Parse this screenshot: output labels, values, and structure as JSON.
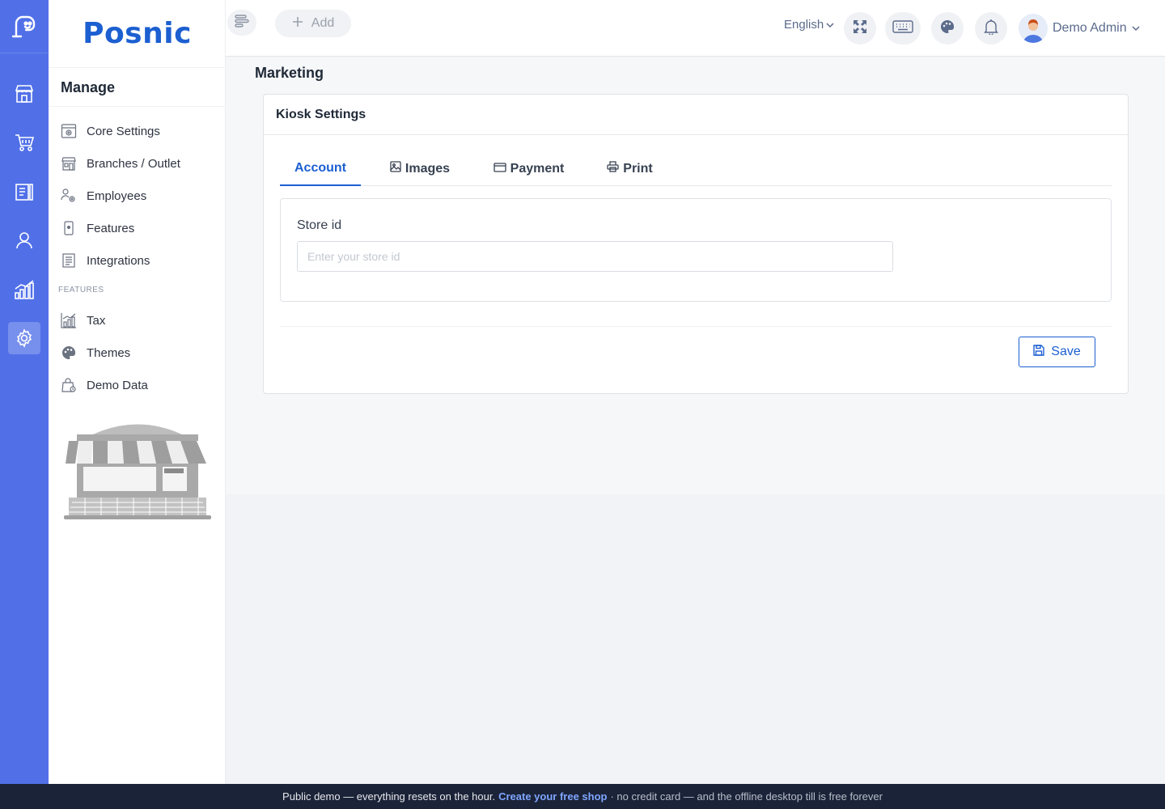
{
  "brand": {
    "name": "Posnic"
  },
  "rail": {
    "items": [
      {
        "icon": "store-icon"
      },
      {
        "icon": "cart-icon"
      },
      {
        "icon": "clipboard-icon"
      },
      {
        "icon": "user-icon"
      },
      {
        "icon": "bar-chart-icon"
      },
      {
        "icon": "gear-icon",
        "active": true
      }
    ]
  },
  "sidebar": {
    "heading": "Manage",
    "items": [
      {
        "label": "Core Settings",
        "icon": "settings-panel-icon"
      },
      {
        "label": "Branches / Outlet",
        "icon": "building-icon"
      },
      {
        "label": "Employees",
        "icon": "users-gear-icon"
      },
      {
        "label": "Features",
        "icon": "mobile-icon"
      },
      {
        "label": "Integrations",
        "icon": "list-doc-icon"
      }
    ],
    "section_label": "FEATURES",
    "feature_items": [
      {
        "label": "Tax",
        "icon": "chart-icon"
      },
      {
        "label": "Themes",
        "icon": "palette-icon"
      },
      {
        "label": "Demo Data",
        "icon": "bag-icon"
      }
    ]
  },
  "topbar": {
    "add_label": "Add",
    "language": "English",
    "user_name": "Demo Admin"
  },
  "page": {
    "title": "Marketing",
    "card_title": "Kiosk Settings",
    "tabs": [
      {
        "label": "Account",
        "active": true
      },
      {
        "label": "Images"
      },
      {
        "label": "Payment"
      },
      {
        "label": "Print"
      }
    ],
    "store_id_label": "Store id",
    "store_id_placeholder": "Enter your store id",
    "store_id_value": "",
    "save_label": "Save"
  },
  "footer": {
    "text1": "Public demo — everything resets on the hour.",
    "link": "Create your free shop",
    "text2": "· no credit card — and the offline desktop till is free forever"
  },
  "colors": {
    "rail": "#5170e8",
    "accent": "#1c5fd1",
    "footer": "#1b2338"
  }
}
